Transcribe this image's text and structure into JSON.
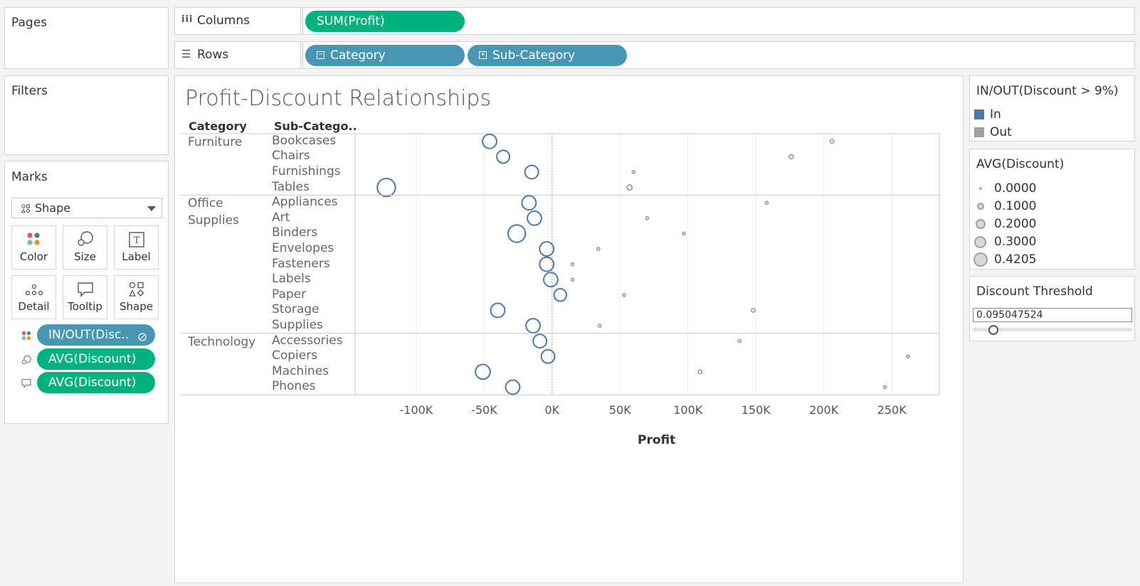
{
  "pages": {
    "title": "Pages"
  },
  "filters": {
    "title": "Filters"
  },
  "columns_shelf": {
    "label": "Columns",
    "pills": [
      "SUM(Profit)"
    ]
  },
  "rows_shelf": {
    "label": "Rows",
    "pills": [
      "Category",
      "Sub-Category"
    ]
  },
  "marks": {
    "title": "Marks",
    "type": "Shape",
    "buttons": [
      "Color",
      "Size",
      "Label",
      "Detail",
      "Tooltip",
      "Shape"
    ],
    "fields": [
      "IN/OUT(Disc..",
      "AVG(Discount)",
      "AVG(Discount)"
    ]
  },
  "legend_color": {
    "title": "IN/OUT(Discount > 9%)",
    "items": [
      {
        "label": "In",
        "color": "#4e79a7"
      },
      {
        "label": "Out",
        "color": "#a0a0a0"
      }
    ]
  },
  "legend_size": {
    "title": "AVG(Discount)",
    "items": [
      "0.0000",
      "0.1000",
      "0.2000",
      "0.3000",
      "0.4205"
    ]
  },
  "parameter": {
    "title": "Discount Threshold",
    "value": "0.095047524",
    "slider_fraction": 0.1
  },
  "chart_data": {
    "type": "scatter",
    "title": "Profit-Discount Relationships",
    "row_headers": [
      "Category",
      "Sub-Catego.."
    ],
    "xlabel": "Profit",
    "xlim": [
      -145000,
      285000
    ],
    "xticks": [
      -100000,
      -50000,
      0,
      50000,
      100000,
      150000,
      200000,
      250000
    ],
    "xtick_labels": [
      "-100K",
      "-50K",
      "0K",
      "50K",
      "100K",
      "150K",
      "200K",
      "250K"
    ],
    "grid": true,
    "legend_position": "right",
    "categories": [
      {
        "name": "Furniture",
        "label_lines": [
          "Furniture"
        ],
        "subcategories": [
          {
            "name": "Bookcases",
            "in_profit": -46000,
            "in_discount": 0.3,
            "out_profit": 206000,
            "out_discount": 0.04
          },
          {
            "name": "Chairs",
            "in_profit": -36000,
            "in_discount": 0.26,
            "out_profit": 176000,
            "out_discount": 0.06
          },
          {
            "name": "Furnishings",
            "in_profit": -15000,
            "in_discount": 0.28,
            "out_profit": 60000,
            "out_discount": 0.0
          },
          {
            "name": "Tables",
            "in_profit": -122000,
            "in_discount": 0.42,
            "out_profit": 57000,
            "out_discount": 0.1
          }
        ]
      },
      {
        "name": "Office Supplies",
        "label_lines": [
          "Office",
          "Supplies"
        ],
        "subcategories": [
          {
            "name": "Appliances",
            "in_profit": -17000,
            "in_discount": 0.3,
            "out_profit": 158000,
            "out_discount": 0.0
          },
          {
            "name": "Art",
            "in_profit": -13000,
            "in_discount": 0.3,
            "out_profit": 70000,
            "out_discount": 0.0
          },
          {
            "name": "Binders",
            "in_profit": -26000,
            "in_discount": 0.4,
            "out_profit": 97000,
            "out_discount": 0.0
          },
          {
            "name": "Envelopes",
            "in_profit": -4000,
            "in_discount": 0.3,
            "out_profit": 34000,
            "out_discount": 0.0
          },
          {
            "name": "Fasteners",
            "in_profit": -4000,
            "in_discount": 0.3,
            "out_profit": 15000,
            "out_discount": 0.0
          },
          {
            "name": "Labels",
            "in_profit": -1000,
            "in_discount": 0.3,
            "out_profit": 15000,
            "out_discount": 0.0
          },
          {
            "name": "Paper",
            "in_profit": 6000,
            "in_discount": 0.25,
            "out_profit": 53000,
            "out_discount": 0.0
          },
          {
            "name": "Storage",
            "in_profit": -40000,
            "in_discount": 0.3,
            "out_profit": 148000,
            "out_discount": 0.04
          },
          {
            "name": "Supplies",
            "in_profit": -14000,
            "in_discount": 0.3,
            "out_profit": 35000,
            "out_discount": 0.0
          }
        ]
      },
      {
        "name": "Technology",
        "label_lines": [
          "Technology"
        ],
        "subcategories": [
          {
            "name": "Accessories",
            "in_profit": -9000,
            "in_discount": 0.28,
            "out_profit": 138000,
            "out_discount": 0.0
          },
          {
            "name": "Copiers",
            "in_profit": -3000,
            "in_discount": 0.28,
            "out_profit": 262000,
            "out_discount": 0.0
          },
          {
            "name": "Machines",
            "in_profit": -51000,
            "in_discount": 0.32,
            "out_profit": 109000,
            "out_discount": 0.04
          },
          {
            "name": "Phones",
            "in_profit": -29000,
            "in_discount": 0.3,
            "out_profit": 245000,
            "out_discount": 0.0
          }
        ]
      }
    ]
  }
}
